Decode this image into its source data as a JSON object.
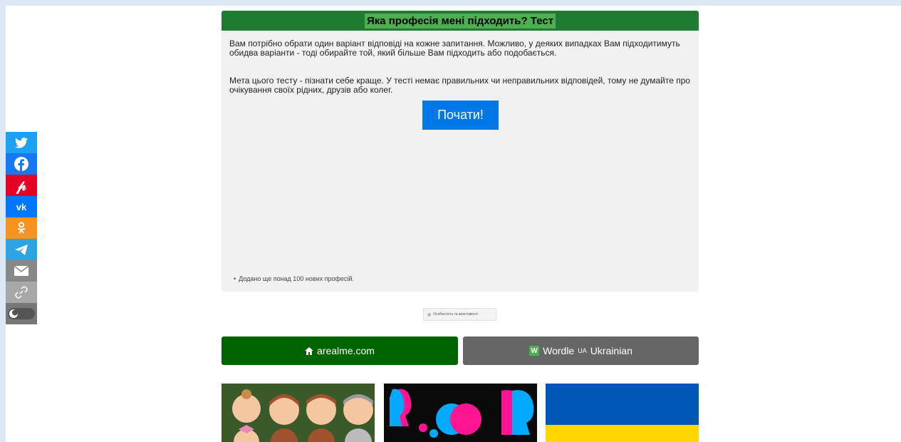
{
  "quiz": {
    "title": "Яка професія мені підходить? Тест",
    "paragraph1": "Вам потрібно обрати один варіант відповіді на кожне запитання. Можливо, у деяких випадках Вам підходитимуть обидва варіанти - тоді обирайте той, який більше Вам підходить або подобається.",
    "paragraph2": "Мета цього тесту - пізнати себе краще. У тесті немає правильних чи неправильних відповідей, тому не думайте про очікування своїх рідних, друзів або колег.",
    "start_label": "Почати!",
    "note": "Додано ще понад 100 нових професій."
  },
  "privacy": {
    "label": "Особистість та властивості"
  },
  "nav": {
    "home_label": "arealme.com",
    "wordle_badge": "W",
    "wordle_label": "Wordle",
    "wordle_ua": "UA",
    "wordle_lang": "Ukrainian"
  },
  "sidebar": {
    "items": [
      {
        "name": "twitter-icon",
        "color": "#1da1f2"
      },
      {
        "name": "facebook-icon",
        "color": "#1877f2"
      },
      {
        "name": "pinterest-icon",
        "color": "#e60023"
      },
      {
        "name": "vk-icon",
        "color": "#0077ff"
      },
      {
        "name": "odnoklassniki-icon",
        "color": "#f7931e"
      },
      {
        "name": "telegram-icon",
        "color": "#2ca5e0"
      },
      {
        "name": "email-icon",
        "color": "#888888"
      },
      {
        "name": "link-icon",
        "color": "#a8a8a8"
      },
      {
        "name": "dark-mode-toggle-icon",
        "color": "#777777"
      }
    ]
  },
  "colors": {
    "header_green": "#1e7b34",
    "start_blue": "#0078e7",
    "home_green": "#006400",
    "wordle_gray": "#666666"
  }
}
